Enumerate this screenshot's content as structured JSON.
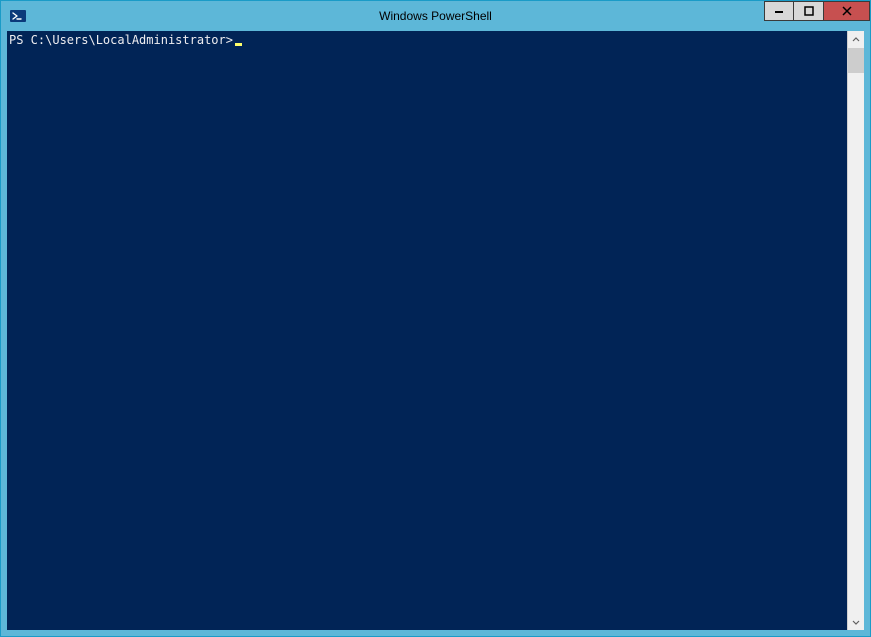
{
  "window": {
    "title": "Windows PowerShell"
  },
  "console": {
    "prompt": "PS C:\\Users\\LocalAdministrator>"
  },
  "colors": {
    "titlebar": "#5db7d8",
    "console_bg": "#012456",
    "console_fg": "#eeedf0",
    "cursor": "#fefe6b",
    "close_btn": "#c75050"
  }
}
